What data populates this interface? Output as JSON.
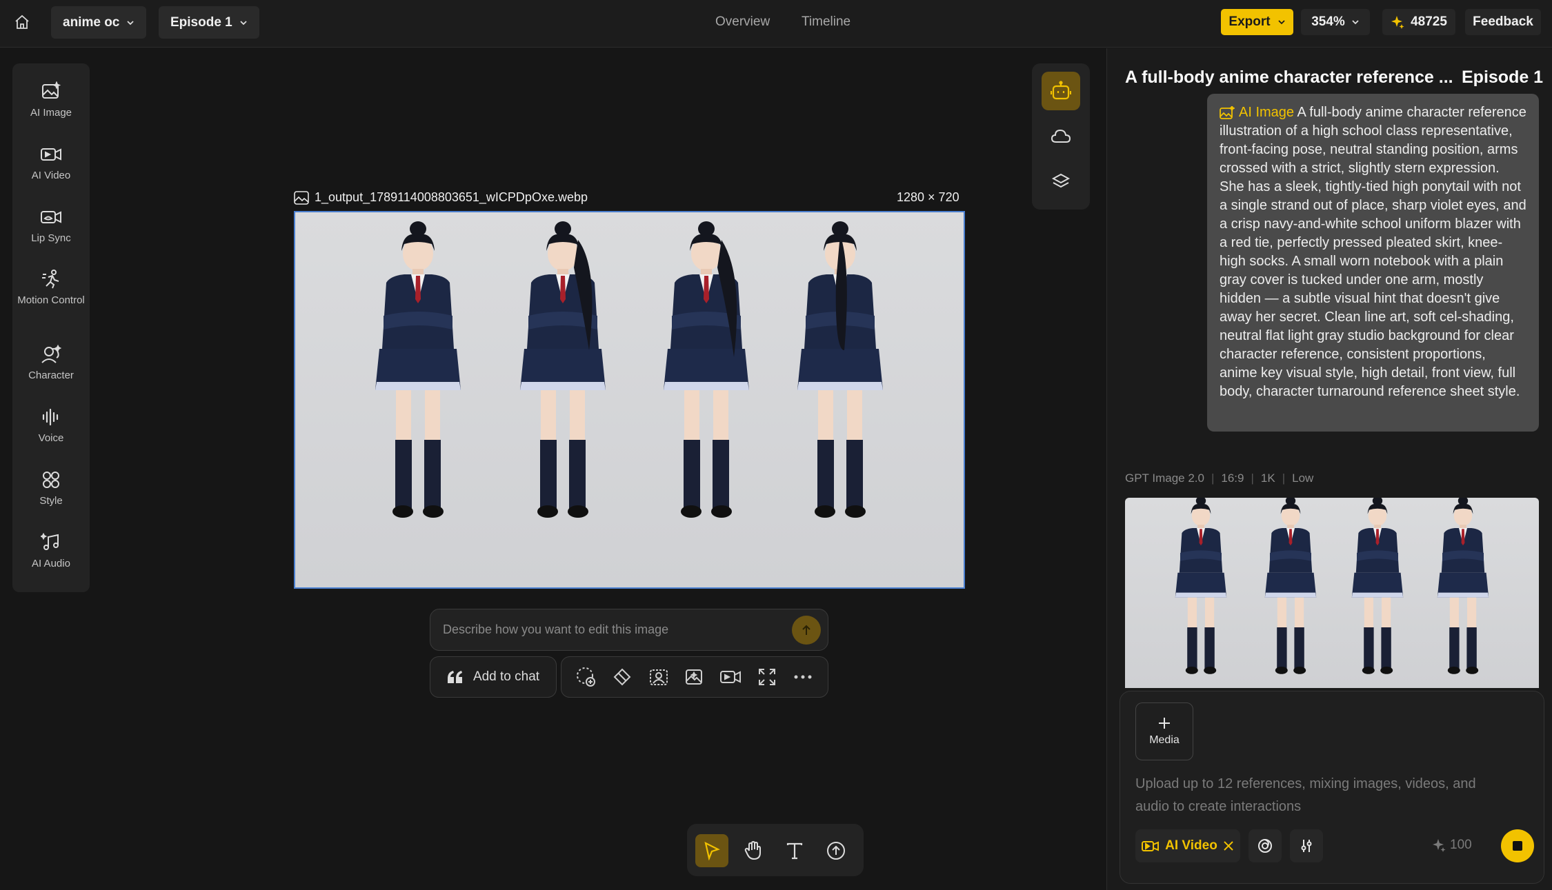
{
  "header": {
    "project_name": "anime oc",
    "episode": "Episode 1",
    "nav": [
      "Overview",
      "Timeline"
    ],
    "export_label": "Export",
    "zoom": "354%",
    "credits": "48725",
    "feedback_label": "Feedback"
  },
  "sidebar": {
    "items": [
      {
        "label": "AI Image",
        "icon": "ai-image-icon"
      },
      {
        "label": "AI Video",
        "icon": "ai-video-icon"
      },
      {
        "label": "Lip Sync",
        "icon": "lip-sync-icon"
      },
      {
        "label": "Motion Control",
        "icon": "motion-control-icon"
      },
      {
        "label": "Character",
        "icon": "character-icon"
      },
      {
        "label": "Voice",
        "icon": "voice-icon"
      },
      {
        "label": "Style",
        "icon": "style-icon"
      },
      {
        "label": "AI Audio",
        "icon": "ai-audio-icon"
      }
    ]
  },
  "canvas": {
    "filename": "1_output_1789114008803651_wICPDpOxe.webp",
    "dimensions": "1280 × 720",
    "edit_placeholder": "Describe how you want to edit this image",
    "add_to_chat": "Add to chat"
  },
  "chat": {
    "title": "A full-body anime character reference ...",
    "episode": "Episode 1",
    "tag": "AI Image",
    "prompt": "A full-body anime character reference illustration of a high school class representative, front-facing pose, neutral standing position, arms crossed with a strict, slightly stern expression. She has a sleek, tightly-tied high ponytail with not a single strand out of place, sharp violet eyes, and a crisp navy-and-white school uniform blazer with a red tie, perfectly pressed pleated skirt, knee-high socks. A small worn notebook with a plain gray cover is tucked under one arm, mostly hidden — a subtle visual hint that doesn't give away her secret. Clean line art, soft cel-shading, neutral flat light gray studio background for clear character reference, consistent proportions, anime key visual style, high detail, front view, full body, character turnaround reference sheet style.",
    "meta": [
      "GPT Image 2.0",
      "16:9",
      "1K",
      "Low"
    ]
  },
  "composer": {
    "media_label": "Media",
    "placeholder": "Upload up to 12 references, mixing images, videos, and audio to create interactions",
    "mode": "AI Video",
    "cost": "100"
  },
  "colors": {
    "accent": "#f2c200",
    "background": "#161616",
    "panel": "#1b1b1b",
    "selection": "#4a7fd0"
  }
}
